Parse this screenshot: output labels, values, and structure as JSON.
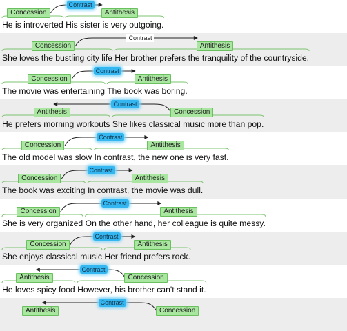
{
  "accent": {
    "span": "#a9e6a0",
    "span_border": "#6abf5e",
    "relation_highlight": "#34b7f0",
    "band_shade": "#ededed"
  },
  "rows": [
    {
      "sentence": "He is introverted His sister is very outgoing.",
      "split": 18,
      "relation": "Contrast",
      "left_label": "Concession",
      "right_label": "Antithesis",
      "direction": "right",
      "highlight": true
    },
    {
      "sentence": "She loves the bustling city life Her brother prefers the tranquility of the countryside.",
      "split": 32,
      "relation": "Contrast",
      "left_label": "Concession",
      "right_label": "Antithesis",
      "direction": "right",
      "highlight": false
    },
    {
      "sentence": "The movie was entertaining The book was boring.",
      "split": 26,
      "relation": "Contrast",
      "left_label": "Concession",
      "right_label": "Antithesis",
      "direction": "right",
      "highlight": true
    },
    {
      "sentence": "He prefers morning workouts She likes classical music more than pop.",
      "split": 27,
      "relation": "Contrast",
      "left_label": "Antithesis",
      "right_label": "Concession",
      "direction": "left",
      "highlight": true
    },
    {
      "sentence": "The old model was slow In contrast, the new one is very fast.",
      "split": 22,
      "relation": "Contrast",
      "left_label": "Concession",
      "right_label": "Antithesis",
      "direction": "right",
      "highlight": true
    },
    {
      "sentence": "The book was exciting In contrast, the movie was dull.",
      "split": 21,
      "relation": "Contrast",
      "left_label": "Concession",
      "right_label": "Antithesis",
      "direction": "right",
      "highlight": true
    },
    {
      "sentence": "She is very organized On the other hand, her colleague is quite messy.",
      "split": 21,
      "relation": "Contrast",
      "left_label": "Concession",
      "right_label": "Antithesis",
      "direction": "right",
      "highlight": true
    },
    {
      "sentence": "She enjoys classical music Her friend prefers rock.",
      "split": 26,
      "relation": "Contrast",
      "left_label": "Concession",
      "right_label": "Antithesis",
      "direction": "right",
      "highlight": true
    },
    {
      "sentence": "He loves spicy food However, his brother can't stand it.",
      "split": 19,
      "relation": "Contrast",
      "left_label": "Antithesis",
      "right_label": "Concession",
      "direction": "left",
      "highlight": true
    },
    {
      "sentence": "",
      "split": 0,
      "relation": "Contrast",
      "left_label": "Antithesis",
      "right_label": "Concession",
      "direction": "left",
      "highlight": true
    }
  ]
}
